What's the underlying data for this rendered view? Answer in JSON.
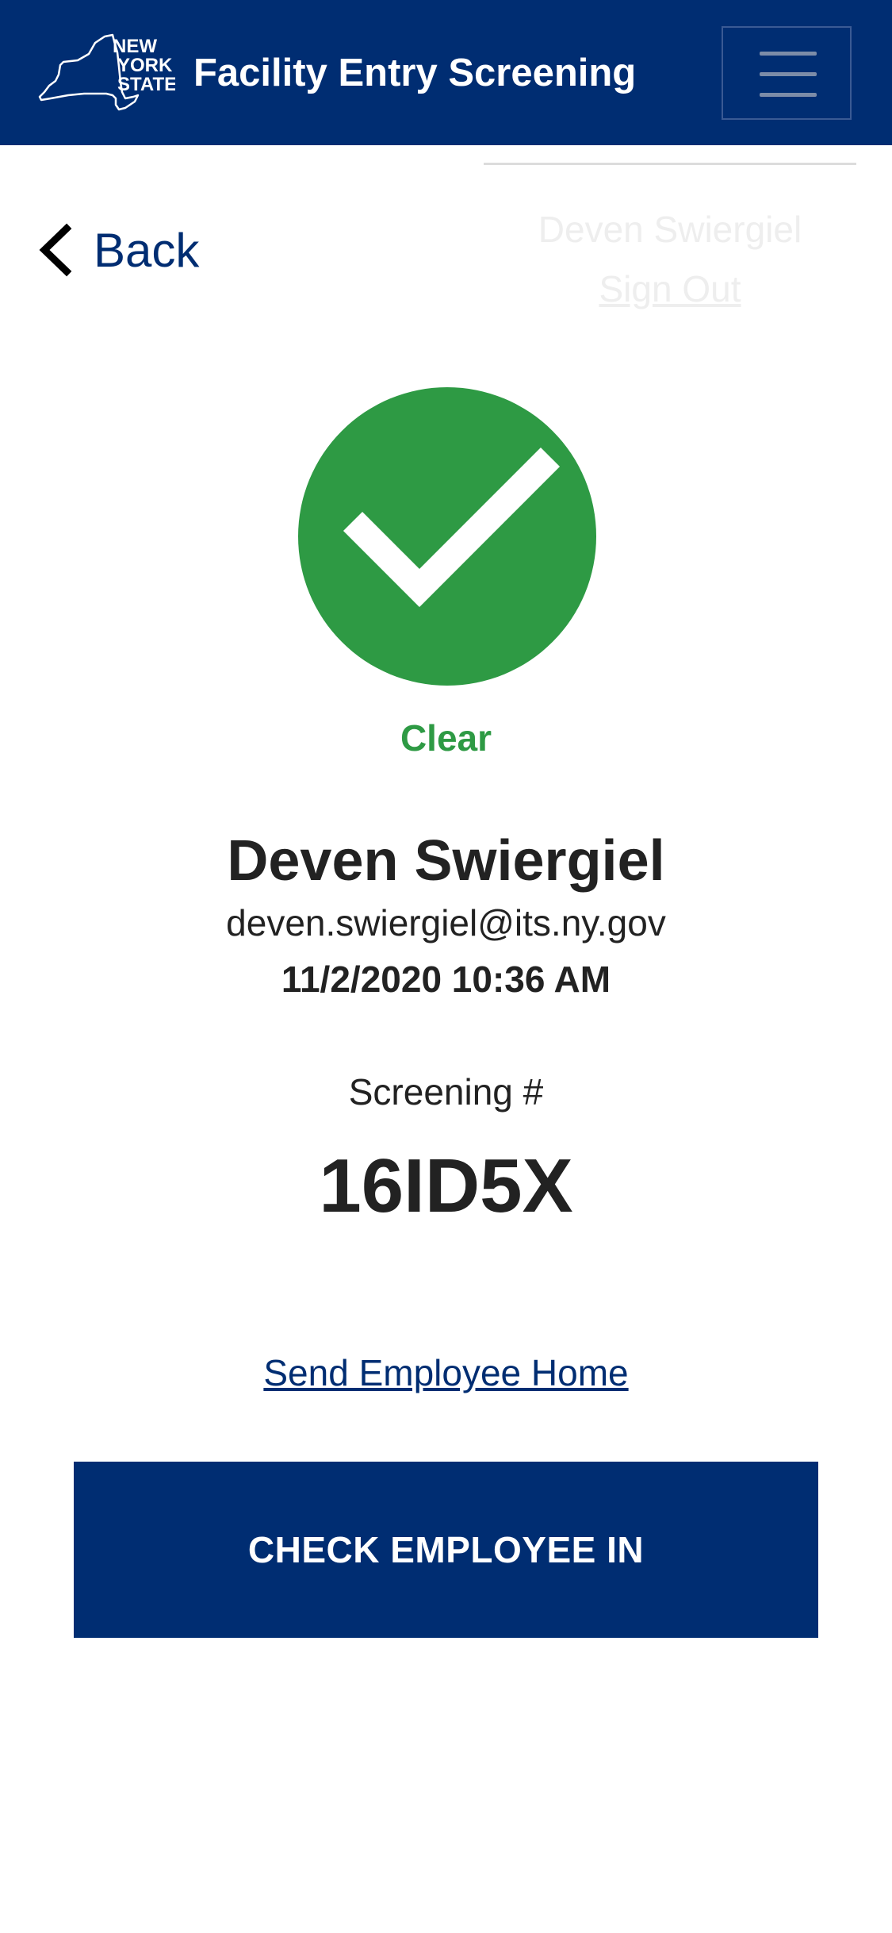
{
  "header": {
    "logo_text": "NEW YORK STATE",
    "title": "Facility Entry Screening",
    "menu_icon": "hamburger-icon",
    "brand_color": "#002d72"
  },
  "user_menu": {
    "user_name": "Deven Swiergiel",
    "sign_out_label": "Sign Out"
  },
  "nav": {
    "back_label": "Back",
    "back_icon": "chevron-left-icon"
  },
  "screening_result": {
    "status_icon": "check-circle-icon",
    "status_label": "Clear",
    "status_color": "#2e9a44",
    "employee_name": "Deven Swiergiel",
    "employee_email": "deven.swiergiel@its.ny.gov",
    "datetime": "11/2/2020 10:36 AM",
    "screening_label": "Screening #",
    "screening_number": "16ID5X"
  },
  "actions": {
    "send_home_label": "Send Employee Home",
    "check_in_label": "CHECK EMPLOYEE IN"
  }
}
